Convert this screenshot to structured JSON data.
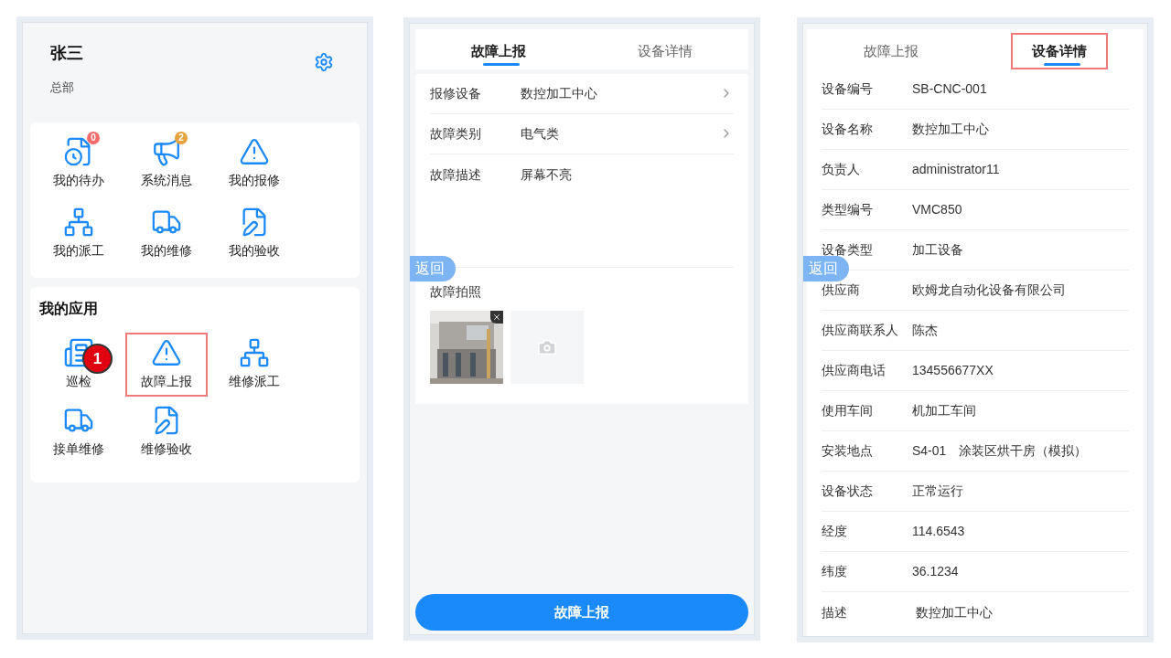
{
  "home": {
    "user": {
      "name": "张三",
      "dept": "总部"
    },
    "quick": [
      {
        "label": "我的待办",
        "kind": "todo",
        "badge": "0",
        "color": "#f56c6c"
      },
      {
        "label": "系统消息",
        "kind": "megaphone",
        "badge": "2",
        "color": "#e6a23c"
      },
      {
        "label": "我的报修",
        "kind": "warning"
      },
      {
        "label": "我的派工",
        "kind": "org"
      },
      {
        "label": "我的维修",
        "kind": "truck"
      },
      {
        "label": "我的验收",
        "kind": "edit"
      }
    ],
    "apps": {
      "title": "我的应用",
      "items": [
        {
          "label": "巡检",
          "kind": "inspect",
          "highlighted": false
        },
        {
          "label": "故障上报",
          "kind": "warning",
          "highlighted": true
        },
        {
          "label": "维修派工",
          "kind": "org",
          "highlighted": false
        },
        {
          "label": "接单维修",
          "kind": "truck",
          "highlighted": false
        },
        {
          "label": "维修验收",
          "kind": "edit",
          "highlighted": false
        }
      ]
    },
    "step_marker": "1"
  },
  "report": {
    "tabs": [
      {
        "label": "故障上报",
        "selected": true,
        "highlighted": false
      },
      {
        "label": "设备详情",
        "selected": false,
        "highlighted": false
      }
    ],
    "fields": [
      {
        "label": "报修设备",
        "value": "数控加工中心",
        "kind": "select"
      },
      {
        "label": "故障类别",
        "value": "电气类",
        "kind": "select"
      },
      {
        "label": "故障描述",
        "value": "屏幕不亮",
        "kind": "textarea"
      }
    ],
    "photos_label": "故障拍照",
    "photos": [
      {
        "kind": "picture"
      },
      {
        "kind": "add"
      }
    ],
    "back": "返回",
    "submit": "故障上报"
  },
  "detail": {
    "tabs": [
      {
        "label": "故障上报",
        "selected": false,
        "highlighted": false
      },
      {
        "label": "设备详情",
        "selected": true,
        "highlighted": true
      }
    ],
    "rows": [
      {
        "label": "设备编号",
        "value": "SB-CNC-001"
      },
      {
        "label": "设备名称",
        "value": "数控加工中心"
      },
      {
        "label": "负责人",
        "value": "administrator11"
      },
      {
        "label": "类型编号",
        "value": "VMC850"
      },
      {
        "label": "设备类型",
        "value": "加工设备"
      },
      {
        "label": "供应商",
        "value": "欧姆龙自动化设备有限公司"
      },
      {
        "label": "供应商联系人",
        "value": "陈杰"
      },
      {
        "label": "供应商电话",
        "value": "134556677XX"
      },
      {
        "label": "使用车间",
        "value": "机加工车间"
      },
      {
        "label": "安装地点",
        "value": "S4-01　涂装区烘干房（模拟）"
      },
      {
        "label": "设备状态",
        "value": "正常运行"
      },
      {
        "label": "经度",
        "value": "114.6543"
      },
      {
        "label": "纬度",
        "value": "36.1234"
      },
      {
        "label": "描述",
        "value": " 数控加工中心"
      }
    ],
    "back": "返回"
  }
}
